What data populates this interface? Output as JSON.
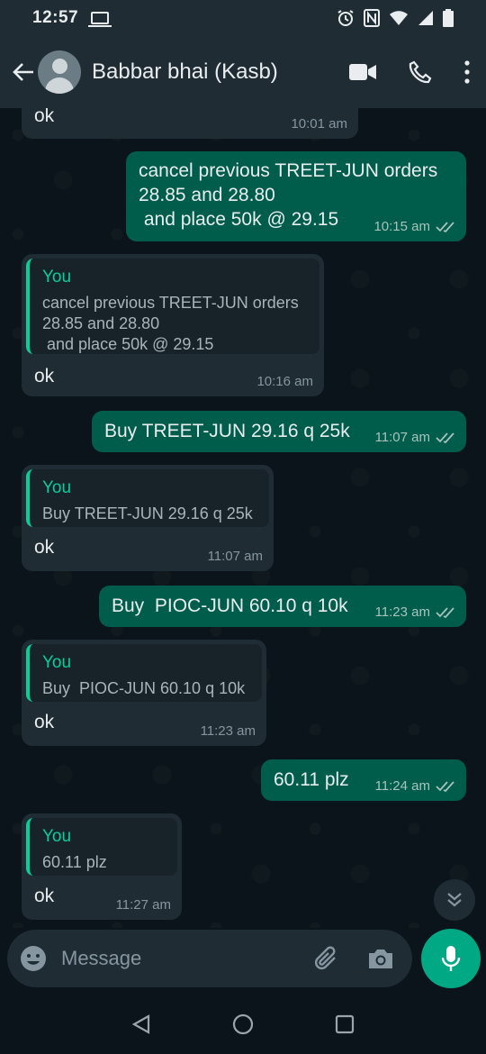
{
  "status_bar": {
    "time": "12:57"
  },
  "header": {
    "contact_name": "Babbar bhai (Kasb)"
  },
  "messages": [
    {
      "dir": "in",
      "text": "ok",
      "time": "10:01 am"
    },
    {
      "dir": "out",
      "text": "cancel previous TREET-JUN orders\n28.85 and 28.80\n and place 50k @ 29.15",
      "time": "10:15 am"
    },
    {
      "dir": "in",
      "quote_author": "You",
      "quote_text": "cancel previous TREET-JUN orders\n28.85 and 28.80\n and place 50k @ 29.15",
      "text": "ok",
      "time": "10:16 am"
    },
    {
      "dir": "out",
      "text": "Buy TREET-JUN 29.16 q 25k",
      "time": "11:07 am"
    },
    {
      "dir": "in",
      "quote_author": "You",
      "quote_text": "Buy TREET-JUN 29.16 q 25k",
      "text": "ok",
      "time": "11:07 am"
    },
    {
      "dir": "out",
      "text": "Buy  PIOC-JUN 60.10 q 10k",
      "time": "11:23 am"
    },
    {
      "dir": "in",
      "quote_author": "You",
      "quote_text": "Buy  PIOC-JUN 60.10 q 10k",
      "text": "ok",
      "time": "11:23 am"
    },
    {
      "dir": "out",
      "text": "60.11 plz",
      "time": "11:24 am"
    },
    {
      "dir": "in",
      "quote_author": "You",
      "quote_text": "60.11 plz",
      "text": "ok",
      "time": "11:27 am"
    }
  ],
  "composer": {
    "placeholder": "Message"
  },
  "colors": {
    "accent": "#00a884",
    "outgoing": "#005c4b",
    "incoming": "#1f2c34",
    "quote_bar": "#06cf9c"
  }
}
